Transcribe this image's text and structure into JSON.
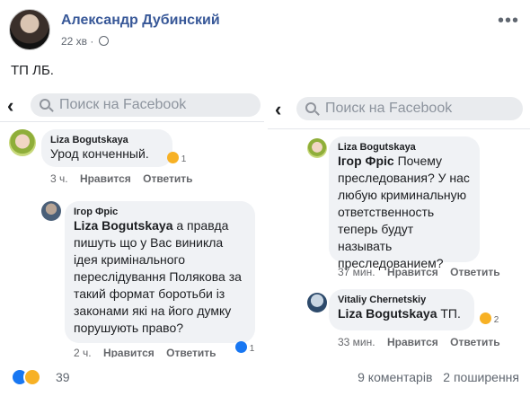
{
  "post": {
    "author": "Александр Дубинский",
    "time": "22 хв",
    "text": "ТП ЛБ."
  },
  "left_shot": {
    "search_placeholder": "Поиск на Facebook",
    "comment1": {
      "name": "Liza Bogutskaya",
      "text": "Урод конченный.",
      "reaction_count": "1",
      "time": "3 ч.",
      "like": "Нравится",
      "reply": "Ответить"
    },
    "comment2": {
      "name": "Ігор Фріс",
      "mention": "Liza Bogutskaya",
      "text": "а правда пишуть що у Вас виникла ідея кримінального переслідування Полякова за такий формат боротьби із законами які на його думку порушують право?",
      "reaction_count": "1",
      "time": "2 ч.",
      "like": "Нравится",
      "reply": "Ответить"
    }
  },
  "right_shot": {
    "search_placeholder": "Поиск на Facebook",
    "comment1": {
      "name": "Liza Bogutskaya",
      "mention": "Ігор Фріс",
      "text": "Почему преследования? У нас любую криминальную ответственность теперь будут называть преследованием?",
      "time": "37 мин.",
      "like": "Нравится",
      "reply": "Ответить"
    },
    "comment2": {
      "name": "Vitaliy Chernetskiy",
      "mention": "Liza Bogutskaya",
      "text": "ТП.",
      "reaction_count": "2",
      "time": "33 мин.",
      "like": "Нравится",
      "reply": "Ответить"
    }
  },
  "footer": {
    "reactions_count": "39",
    "comments": "9 коментарів",
    "shares": "2 поширення"
  },
  "colors": {
    "author_link": "#385898",
    "like_blue": "#1877f2",
    "haha_yellow": "#f7b125"
  }
}
